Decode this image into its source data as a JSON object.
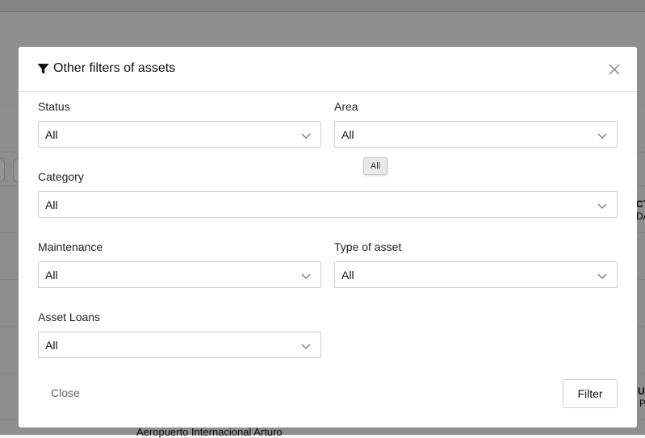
{
  "background": {
    "edge_text_1": "CT",
    "edge_text_2": "DA",
    "edge_text_3": "U",
    "edge_text_4": "P",
    "bottom_text": "Aeropuerto Internacional Arturo"
  },
  "modal": {
    "title": "Other filters of assets",
    "status": {
      "label": "Status",
      "value": "All"
    },
    "area": {
      "label": "Area",
      "value": "All"
    },
    "tooltip": "All",
    "category": {
      "label": "Category",
      "value": "All"
    },
    "maintenance": {
      "label": "Maintenance",
      "value": "All"
    },
    "type_of_asset": {
      "label": "Type of asset",
      "value": "All"
    },
    "asset_loans": {
      "label": "Asset Loans",
      "value": "All"
    },
    "close_label": "Close",
    "filter_label": "Filter"
  }
}
